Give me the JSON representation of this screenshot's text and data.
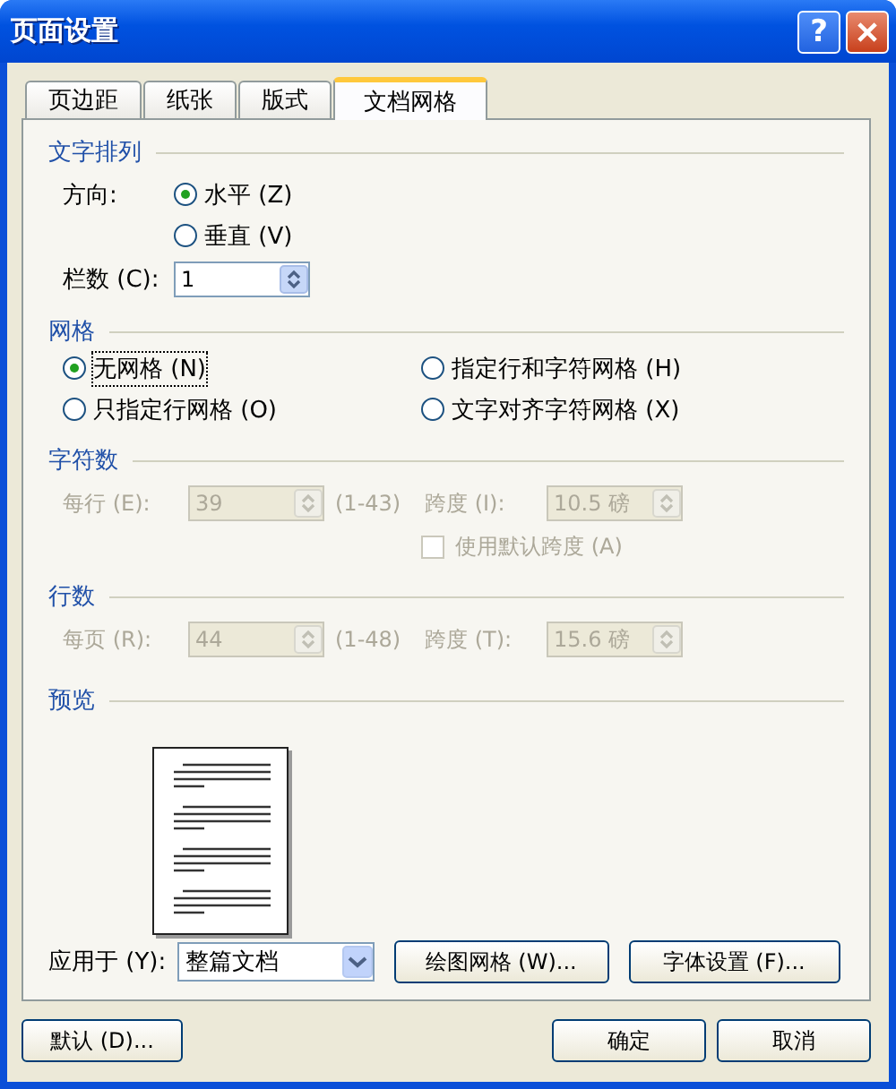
{
  "window": {
    "title": "页面设置",
    "help_button": "?"
  },
  "tabs": [
    {
      "label": "页边距",
      "selected": false
    },
    {
      "label": "纸张",
      "selected": false
    },
    {
      "label": "版式",
      "selected": false
    },
    {
      "label": "文档网格",
      "selected": true
    }
  ],
  "text_layout": {
    "title": "文字排列",
    "direction_label": "方向:",
    "directions": [
      {
        "label": "水平 (Z)",
        "selected": true
      },
      {
        "label": "垂直 (V)",
        "selected": false
      }
    ],
    "columns_label": "栏数 (C):",
    "columns_value": "1"
  },
  "grid": {
    "title": "网格",
    "options": [
      {
        "label": "无网格 (N)",
        "selected": true,
        "focused": true
      },
      {
        "label": "指定行和字符网格 (H)",
        "selected": false,
        "focused": false
      },
      {
        "label": "只指定行网格 (O)",
        "selected": false,
        "focused": false
      },
      {
        "label": "文字对齐字符网格 (X)",
        "selected": false,
        "focused": false
      }
    ]
  },
  "characters": {
    "title": "字符数",
    "label": "每行 (E):",
    "value": "39",
    "range": "(1-43)",
    "pitch_label": "跨度 (I):",
    "pitch_value": "10.5 磅",
    "disabled": true,
    "default_pitch": {
      "label": "使用默认跨度 (A)",
      "checked": false,
      "disabled": true
    }
  },
  "lines": {
    "title": "行数",
    "label": "每页 (R):",
    "value": "44",
    "range": "(1-48)",
    "pitch_label": "跨度 (T):",
    "pitch_value": "15.6 磅",
    "disabled": true
  },
  "preview": {
    "title": "预览"
  },
  "apply_to": {
    "label": "应用于 (Y):",
    "value": "整篇文档"
  },
  "panel_buttons": [
    "绘图网格 (W)...",
    "字体设置 (F)..."
  ],
  "footer": {
    "default_button": "默认 (D)...",
    "buttons": [
      "确定",
      "取消"
    ]
  }
}
